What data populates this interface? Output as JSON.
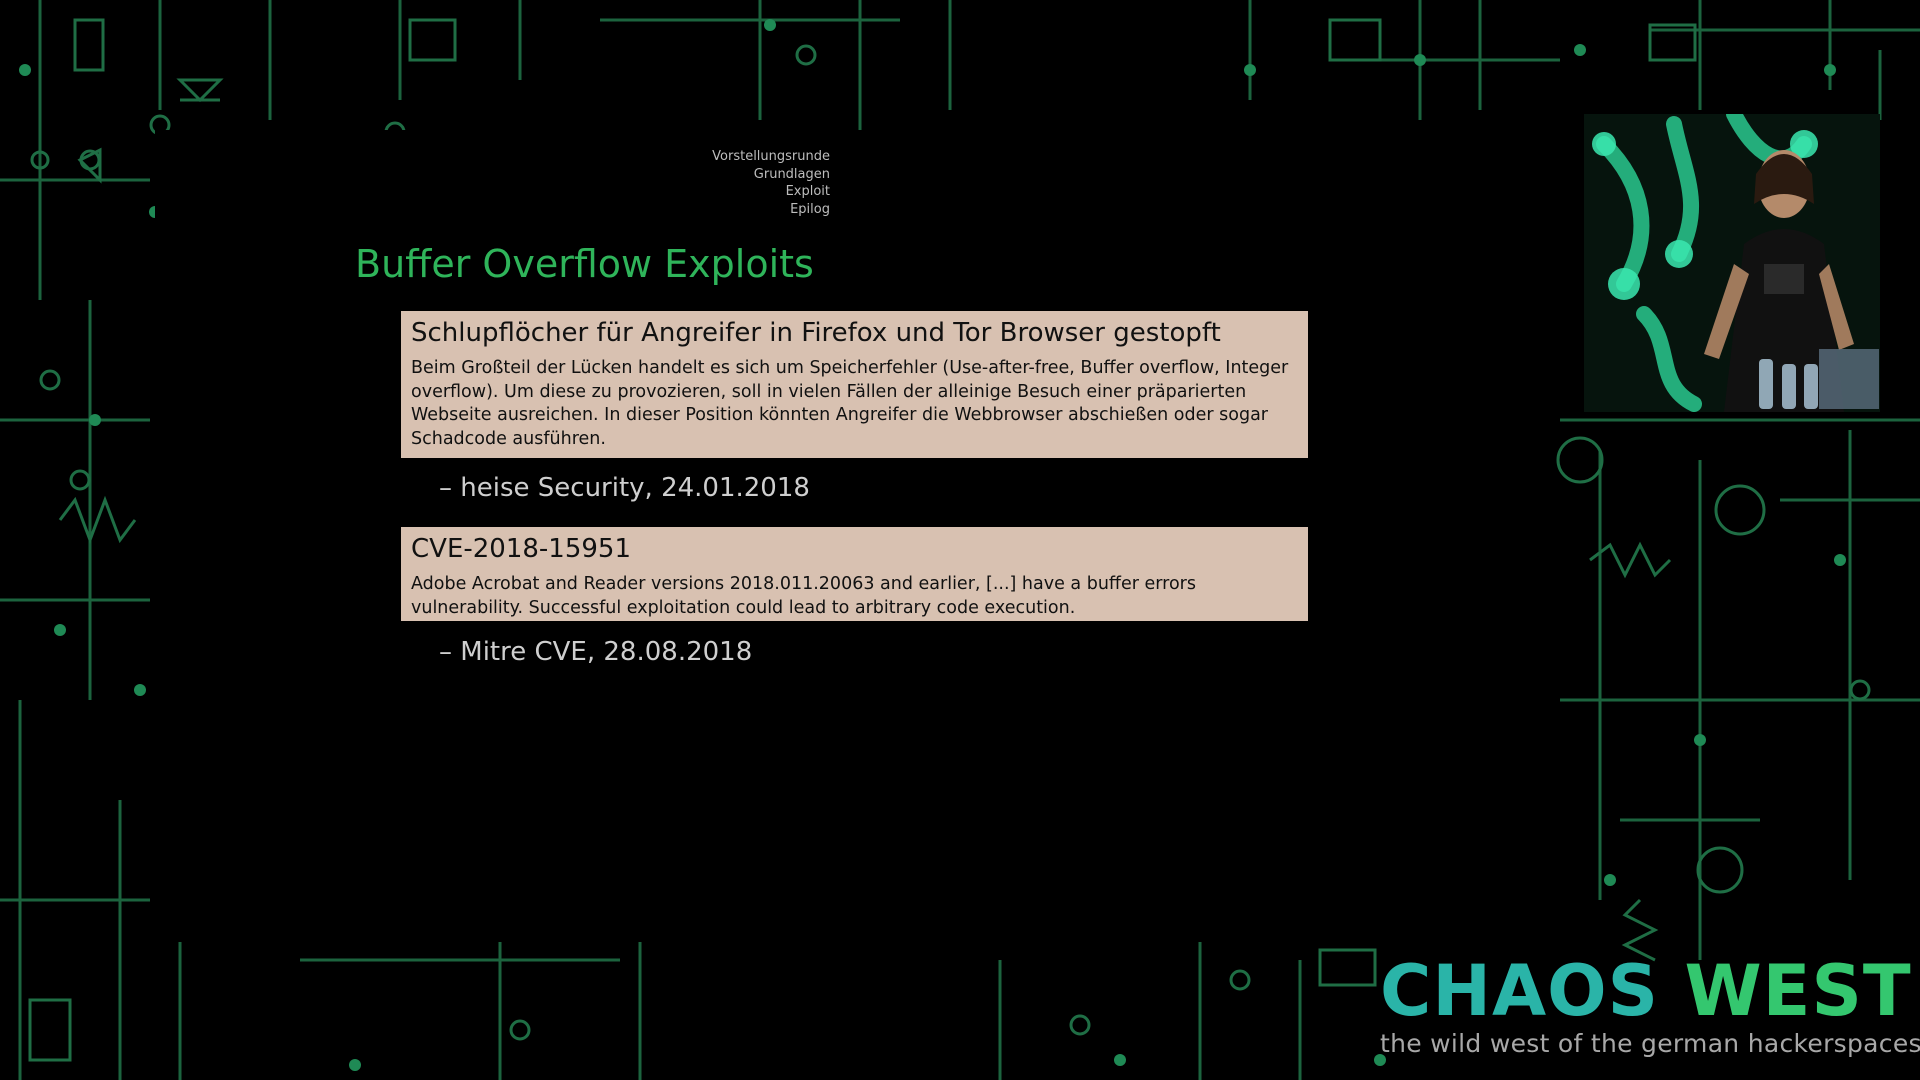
{
  "slide": {
    "nav": [
      "Vorstellungsrunde",
      "Grundlagen",
      "Exploit",
      "Epilog"
    ],
    "title": "Buffer Overflow Exploits",
    "quotes": [
      {
        "heading": "Schlupflöcher für Angreifer in Firefox und Tor Browser gestopft",
        "body": "Beim Großteil der Lücken handelt es sich um Speicherfehler (Use-after-free, Buffer overflow, Integer overflow). Um diese zu provozieren, soll in vielen Fällen der alleinige Besuch einer präparierten Webseite ausreichen. In dieser Position könnten Angreifer die Webbrowser abschießen oder sogar Schadcode ausführen.",
        "source": "– heise Security, 24.01.2018"
      },
      {
        "heading": "CVE-2018-15951",
        "body": "Adobe Acrobat and Reader versions 2018.011.20063 and earlier, [...] have a buffer errors vulnerability. Successful exploitation could lead to arbitrary code execution.",
        "source": "– Mitre CVE, 28.08.2018"
      }
    ]
  },
  "branding": {
    "logo_word1": "CHAOS",
    "logo_word2": "WEST",
    "tagline": "the wild west of the german hackerspaces"
  },
  "colors": {
    "title": "#2fb45a",
    "quote_box": "#d8c1b1",
    "circuit_lines": "#1f6e45",
    "logo_teal": "#2ab4a8",
    "logo_green": "#34c76f"
  }
}
